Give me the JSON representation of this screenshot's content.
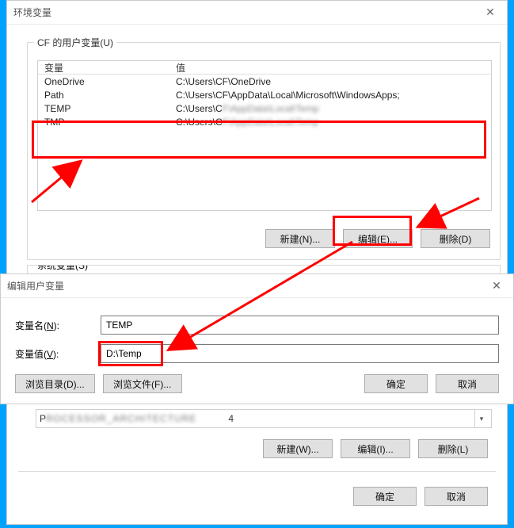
{
  "env_dialog": {
    "title": "环境变量",
    "user_group_label": "CF 的用户变量(U)",
    "sys_group_label_partial": "系统变量(S)",
    "columns": {
      "var": "变量",
      "val": "值"
    },
    "rows": [
      {
        "var": "OneDrive",
        "val": "C:\\Users\\CF\\OneDrive"
      },
      {
        "var": "Path",
        "val": "C:\\Users\\CF\\AppData\\Local\\Microsoft\\WindowsApps;"
      },
      {
        "var": "TEMP",
        "val_prefix": "C:\\Users\\C",
        "val_blur": "F\\AppData\\Local\\Temp"
      },
      {
        "var": "TMP",
        "val_prefix": "C:\\Users\\C",
        "val_blur": "F\\AppData\\Local\\Temp"
      }
    ],
    "user_buttons": {
      "new": "新建(N)...",
      "edit": "编辑(E)...",
      "del": "删除(D)"
    },
    "sys_list_row": {
      "prefix": "P",
      "blur": "ROCESSOR_ARCHITECTURE",
      "suffix": "4"
    },
    "sys_buttons": {
      "new": "新建(W)...",
      "edit": "编辑(I)...",
      "del": "删除(L)"
    },
    "main_buttons": {
      "ok": "确定",
      "cancel": "取消"
    }
  },
  "edit_dialog": {
    "title": "编辑用户变量",
    "name_label_pre": "变量名(",
    "name_label_u": "N",
    "name_label_post": "):",
    "val_label_pre": "变量值(",
    "val_label_u": "V",
    "val_label_post": "):",
    "name_value": "TEMP",
    "val_value": "D:\\Temp",
    "browse_dir": "浏览目录(D)...",
    "browse_file": "浏览文件(F)...",
    "ok": "确定",
    "cancel": "取消"
  }
}
